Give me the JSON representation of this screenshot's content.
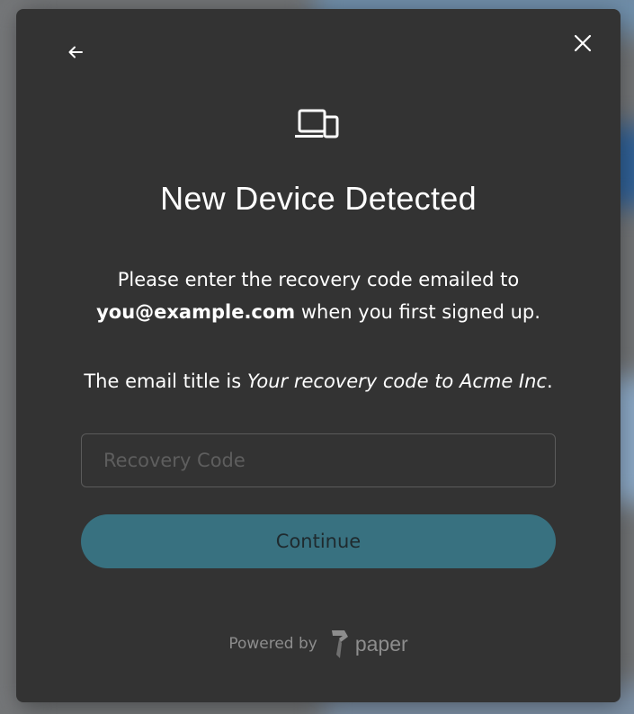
{
  "modal": {
    "title": "New Device Detected",
    "description_line1": "Please enter the recovery code emailed to",
    "email": "you@example.com",
    "description_line2_suffix": " when you first signed up.",
    "email_title_prefix": "The email title is ",
    "email_title": "Your recovery code to Acme Inc",
    "email_title_suffix": ".",
    "input": {
      "placeholder": "Recovery Code",
      "value": ""
    },
    "continue_label": "Continue",
    "powered_by_label": "Powered by",
    "brand_name": "paper"
  },
  "icons": {
    "back": "arrow-left-icon",
    "close": "close-icon",
    "devices": "devices-icon",
    "brand_logo": "paper-logo-icon"
  },
  "colors": {
    "modal_bg": "#333333",
    "button_bg": "#387180",
    "text": "#ffffff",
    "muted": "#8d8d8d"
  }
}
